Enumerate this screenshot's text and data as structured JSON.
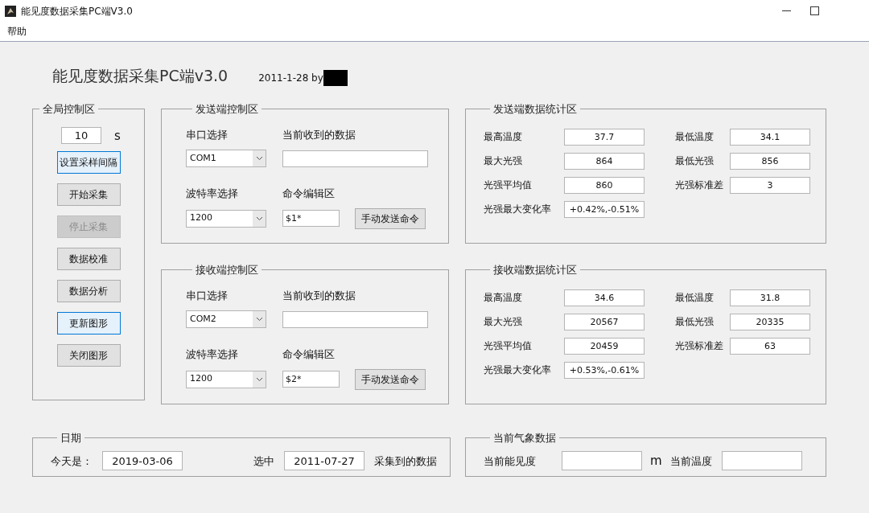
{
  "window": {
    "title": "能见度数据采集PC端V3.0"
  },
  "menu": [
    "帮助"
  ],
  "header": {
    "title": "能见度数据采集PC端v3.0",
    "date_by": "2011-1-28 by"
  },
  "global_panel": {
    "title": "全局控制区",
    "interval": "10",
    "unit": "s",
    "buttons": [
      {
        "label": "设置采样间隔",
        "disabled": false,
        "focused": true
      },
      {
        "label": "开始采集",
        "disabled": false,
        "focused": false
      },
      {
        "label": "停止采集",
        "disabled": true,
        "focused": false
      },
      {
        "label": "数据校准",
        "disabled": false,
        "focused": false
      },
      {
        "label": "数据分析",
        "disabled": false,
        "focused": false
      },
      {
        "label": "更新图形",
        "disabled": false,
        "focused": true
      },
      {
        "label": "关闭图形",
        "disabled": false,
        "focused": false
      }
    ]
  },
  "control_panels": [
    {
      "title": "发送端控制区",
      "port_label": "串口选择",
      "port": "COM1",
      "data_label": "当前收到的数据",
      "baud_label": "波特率选择",
      "baud": "1200",
      "cmd_label": "命令编辑区",
      "command": "$1*",
      "send_button": "手动发送命令"
    },
    {
      "title": "接收端控制区",
      "port_label": "串口选择",
      "port": "COM2",
      "data_label": "当前收到的数据",
      "baud_label": "波特率选择",
      "baud": "1200",
      "cmd_label": "命令编辑区",
      "command": "$2*",
      "send_button": "手动发送命令"
    }
  ],
  "stats_panels": [
    {
      "title": "发送端数据统计区",
      "fields": [
        {
          "label": "最高温度",
          "value": "37.7"
        },
        {
          "label": "最低温度",
          "value": "34.1"
        },
        {
          "label": "最大光强",
          "value": "864"
        },
        {
          "label": "最低光强",
          "value": "856"
        },
        {
          "label": "光强平均值",
          "value": "860"
        },
        {
          "label": "光强标准差",
          "value": "3"
        },
        {
          "label": "光强最大变化率",
          "value": "+0.42%,-0.51%"
        }
      ]
    },
    {
      "title": "接收端数据统计区",
      "fields": [
        {
          "label": "最高温度",
          "value": "34.6"
        },
        {
          "label": "最低温度",
          "value": "31.8"
        },
        {
          "label": "最大光强",
          "value": "20567"
        },
        {
          "label": "最低光强",
          "value": "20335"
        },
        {
          "label": "光强平均值",
          "value": "20459"
        },
        {
          "label": "光强标准差",
          "value": "63"
        },
        {
          "label": "光强最大变化率",
          "value": "+0.53%,-0.61%"
        }
      ]
    }
  ],
  "date_panel": {
    "title": "日期",
    "today_label": "今天是：",
    "today": "2019-03-06",
    "selected_label": "选中",
    "selected_date": "2011-07-27",
    "suffix": "采集到的数据"
  },
  "weather_panel": {
    "title": "当前气象数据",
    "visibility_label": "当前能见度",
    "unit": "m",
    "temp_label": "当前温度"
  }
}
